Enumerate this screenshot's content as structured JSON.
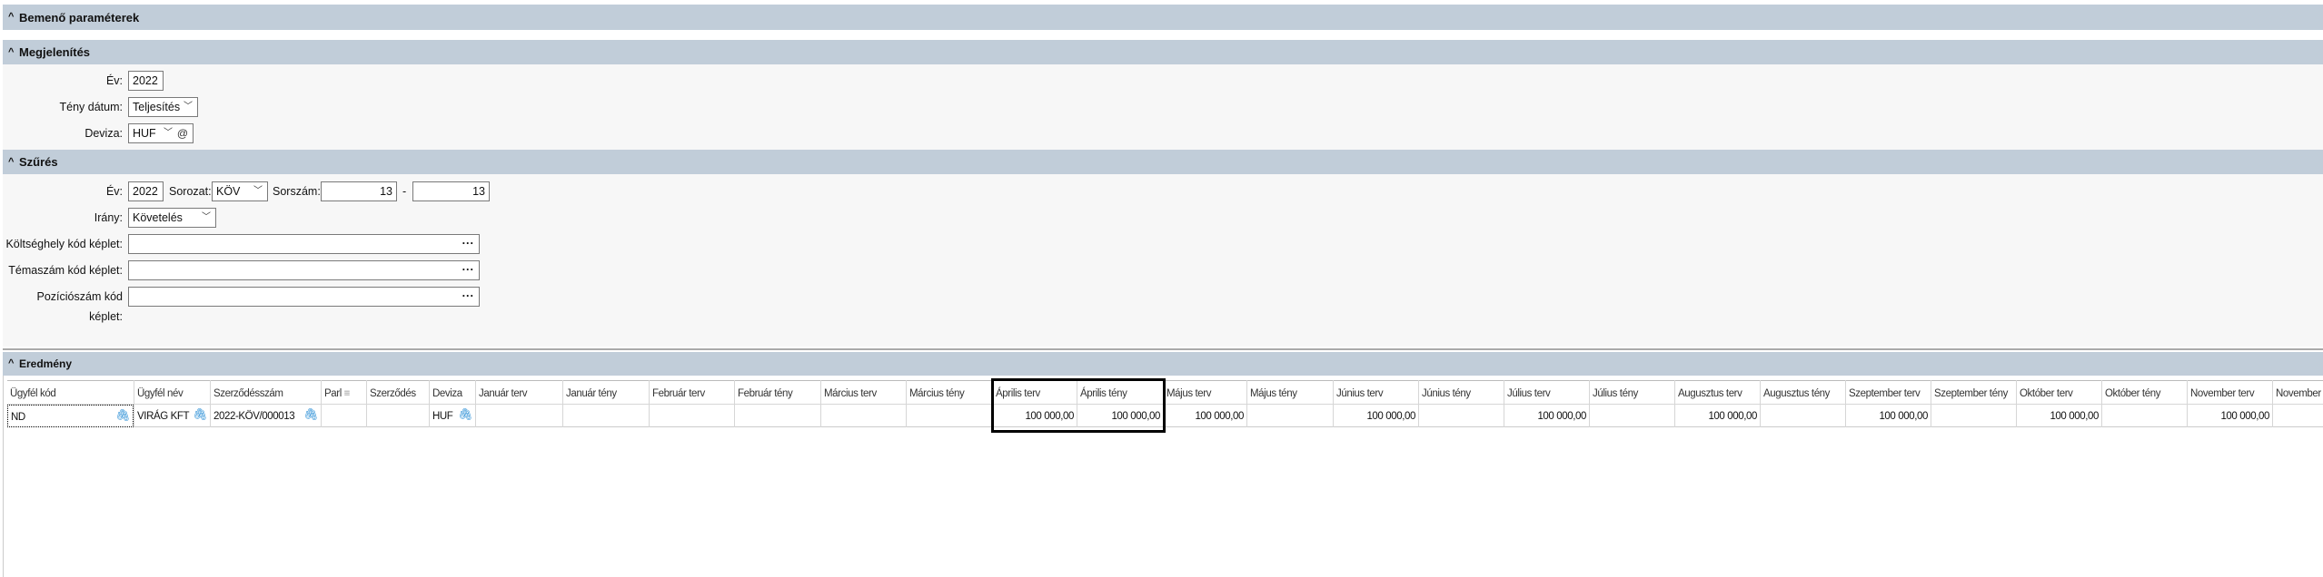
{
  "sections": {
    "input": "Bemenő paraméterek",
    "display": "Megjelenítés",
    "filter": "Szűrés",
    "result": "Eredmény"
  },
  "display": {
    "year_label": "Év:",
    "year": "2022",
    "date_label": "Tény dátum:",
    "date_value": "Teljesítés",
    "currency_label": "Deviza:",
    "currency": "HUF"
  },
  "filter": {
    "year_label": "Év:",
    "year": "2022",
    "series_label": "Sorozat:",
    "series": "KÖV",
    "serial_label": "Sorszám:",
    "serial_from": "13",
    "dash": "-",
    "serial_to": "13",
    "direction_label": "Irány:",
    "direction": "Követelés",
    "cost_label": "Költséghely kód képlet:",
    "topic_label": "Témaszám kód képlet:",
    "position_label": "Pozíciószám kód képlet:",
    "cost": "",
    "topic": "",
    "position": ""
  },
  "grid": {
    "columns": [
      {
        "label": "Ügyfél kód",
        "w": 140
      },
      {
        "label": "Ügyfél név",
        "w": 84
      },
      {
        "label": "Szerződésszám",
        "w": 122
      },
      {
        "label": "Parl",
        "w": 50,
        "filter": true
      },
      {
        "label": "Szerződés",
        "w": 69
      },
      {
        "label": "Deviza",
        "w": 51
      },
      {
        "label": "Január terv",
        "w": 96
      },
      {
        "label": "Január tény",
        "w": 95
      },
      {
        "label": "Február terv",
        "w": 94
      },
      {
        "label": "Február tény",
        "w": 95
      },
      {
        "label": "Március terv",
        "w": 94
      },
      {
        "label": "Március tény",
        "w": 95
      },
      {
        "label": "Április terv",
        "w": 93
      },
      {
        "label": "Április tény",
        "w": 95
      },
      {
        "label": "Május terv",
        "w": 92
      },
      {
        "label": "Május tény",
        "w": 95
      },
      {
        "label": "Június terv",
        "w": 94
      },
      {
        "label": "Június tény",
        "w": 94
      },
      {
        "label": "Július terv",
        "w": 94
      },
      {
        "label": "Július tény",
        "w": 94
      },
      {
        "label": "Augusztus terv",
        "w": 94
      },
      {
        "label": "Augusztus tény",
        "w": 94
      },
      {
        "label": "Szeptember terv",
        "w": 94
      },
      {
        "label": "Szeptember tény",
        "w": 94
      },
      {
        "label": "Október terv",
        "w": 94
      },
      {
        "label": "Október tény",
        "w": 94
      },
      {
        "label": "November terv",
        "w": 94
      },
      {
        "label": "November tény",
        "w": 94
      }
    ],
    "rows": [
      [
        "ND",
        "VIRÁG KFT",
        "2022-KÖV/000013",
        "",
        "",
        "HUF",
        "",
        "",
        "",
        "",
        "",
        "",
        "100 000,00",
        "100 000,00",
        "100 000,00",
        "",
        "100 000,00",
        "",
        "100 000,00",
        "",
        "100 000,00",
        "",
        "100 000,00",
        "",
        "100 000,00",
        "",
        "100 000,00",
        ""
      ]
    ],
    "clip_columns": [
      0,
      1,
      2,
      5
    ],
    "highlight_columns": [
      12,
      13
    ]
  }
}
